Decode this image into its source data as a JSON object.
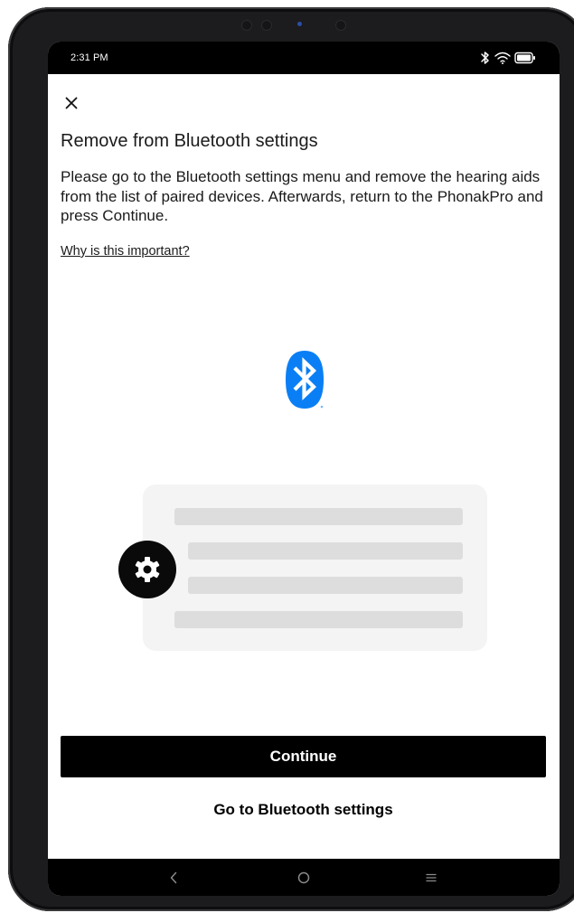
{
  "status_bar": {
    "time": "2:31 PM",
    "icons": [
      "bluetooth-icon",
      "wifi-icon",
      "battery-icon"
    ]
  },
  "header": {
    "close_icon": "close-icon"
  },
  "content": {
    "title": "Remove from Bluetooth settings",
    "body": "Please go to the Bluetooth settings menu and remove the hearing aids from the list of paired devices. Afterwards, return to the PhonakPro and press Continue.",
    "link": "Why is this important?"
  },
  "illustration": {
    "logo_icon": "bluetooth-logo-icon",
    "settings_icon": "gear-icon",
    "list_rows": 4
  },
  "actions": {
    "primary_label": "Continue",
    "secondary_label": "Go to Bluetooth settings"
  },
  "navigation": {
    "keys": [
      "back-icon",
      "home-icon",
      "menu-icon"
    ]
  },
  "colors": {
    "accent": "#000000",
    "bluetooth_blue": "#0a7ff5",
    "placeholder_bar": "#dddddd",
    "card_background": "#f4f4f4"
  }
}
